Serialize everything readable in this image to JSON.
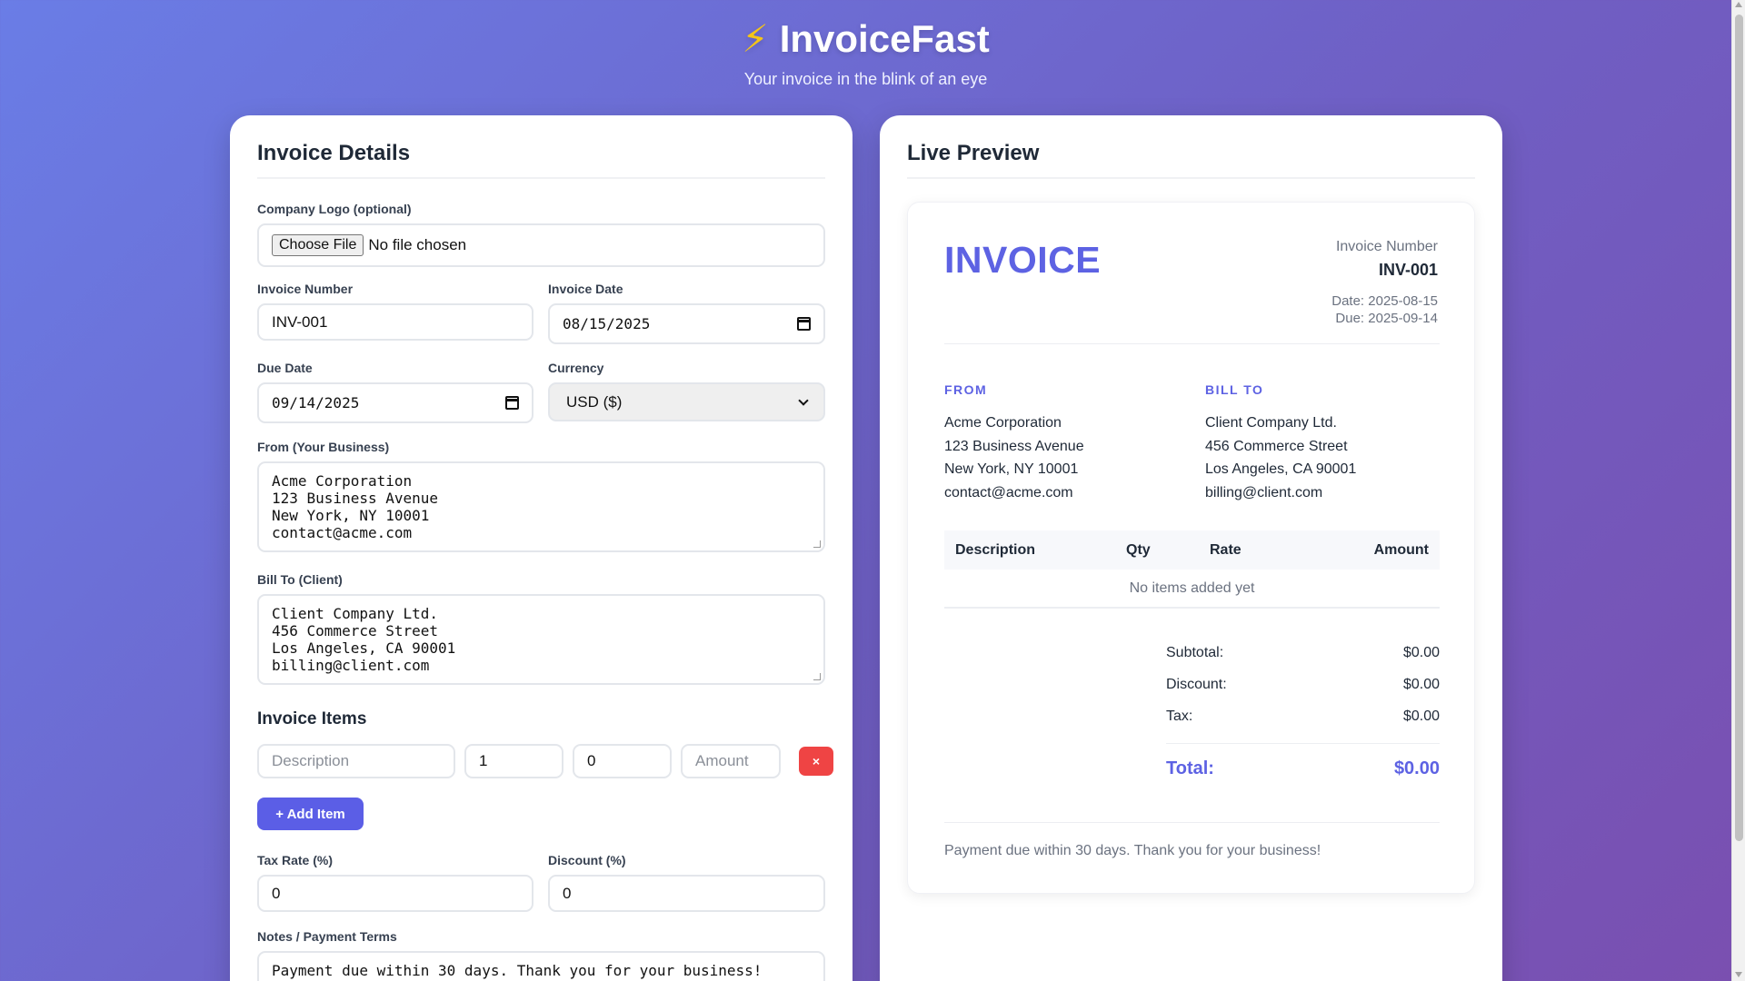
{
  "app": {
    "title": "InvoiceFast",
    "tagline": "Your invoice in the blink of an eye",
    "icon": "lightning-bolt-icon",
    "accent_color": "#5d62e3",
    "danger_color": "#ef4444"
  },
  "form": {
    "panel_title": "Invoice Details",
    "logo": {
      "label": "Company Logo (optional)",
      "button": "Choose File",
      "status": "No file chosen"
    },
    "invoice_number": {
      "label": "Invoice Number",
      "value": "INV-001"
    },
    "invoice_date": {
      "label": "Invoice Date",
      "value": "08/15/2025"
    },
    "due_date": {
      "label": "Due Date",
      "value": "09/14/2025"
    },
    "currency": {
      "label": "Currency",
      "value": "USD ($)"
    },
    "from": {
      "label": "From (Your Business)",
      "lines": [
        "Acme Corporation",
        "123 Business Avenue",
        "New York, NY 10001",
        "contact@acme.com"
      ]
    },
    "bill_to": {
      "label": "Bill To (Client)",
      "lines": [
        "Client Company Ltd.",
        "456 Commerce Street",
        "Los Angeles, CA 90001",
        "billing@client.com"
      ]
    },
    "items_title": "Invoice Items",
    "item": {
      "description_placeholder": "Description",
      "qty": "1",
      "rate": "0",
      "amount_placeholder": "Amount",
      "remove_label": "×"
    },
    "add_item_label": "+ Add Item",
    "tax_rate": {
      "label": "Tax Rate (%)",
      "value": "0"
    },
    "discount": {
      "label": "Discount (%)",
      "value": "0"
    },
    "notes": {
      "label": "Notes / Payment Terms",
      "value": "Payment due within 30 days. Thank you for your business!"
    }
  },
  "preview": {
    "panel_title": "Live Preview",
    "heading": "INVOICE",
    "number_label": "Invoice Number",
    "number": "INV-001",
    "date_line": "Date: 2025-08-15",
    "due_line": "Due: 2025-09-14",
    "from_heading": "FROM",
    "from_lines": [
      "Acme Corporation",
      "123 Business Avenue",
      "New York, NY 10001",
      "contact@acme.com"
    ],
    "bill_heading": "BILL TO",
    "bill_lines": [
      "Client Company Ltd.",
      "456 Commerce Street",
      "Los Angeles, CA 90001",
      "billing@client.com"
    ],
    "table_headers": [
      "Description",
      "Qty",
      "Rate",
      "Amount"
    ],
    "empty_message": "No items added yet",
    "subtotal_label": "Subtotal:",
    "subtotal": "$0.00",
    "discount_label": "Discount:",
    "discount": "$0.00",
    "tax_label": "Tax:",
    "tax": "$0.00",
    "total_label": "Total:",
    "total": "$0.00",
    "notes": "Payment due within 30 days. Thank you for your business!"
  }
}
